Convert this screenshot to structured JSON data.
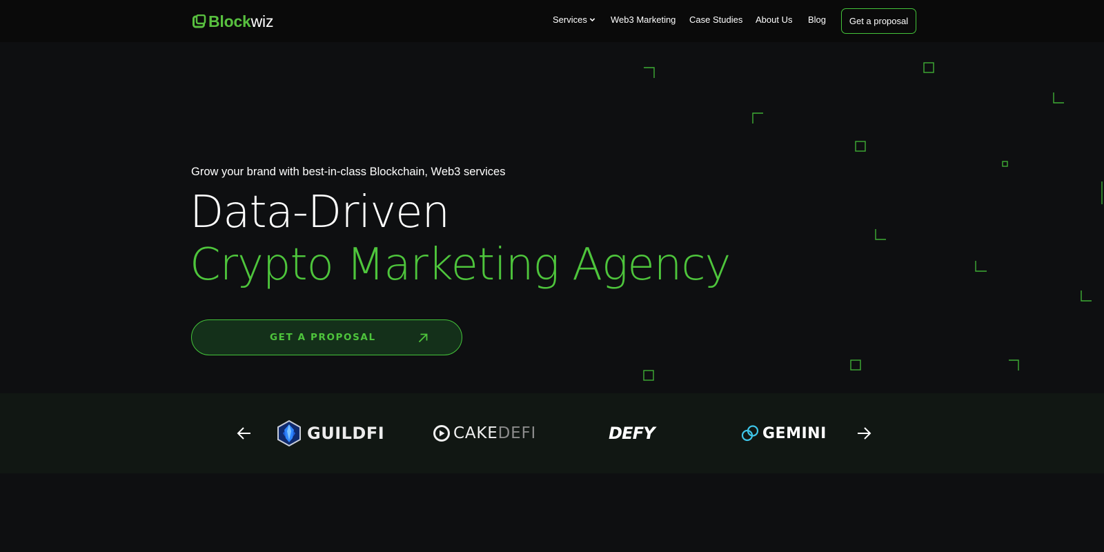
{
  "header": {
    "logo": {
      "part_a": "Block",
      "part_b": "wiz",
      "brand_color": "#58c03f"
    },
    "nav": [
      {
        "label": "Services",
        "has_dropdown": true
      },
      {
        "label": "Web3 Marketing"
      },
      {
        "label": "Case Studies"
      },
      {
        "label": "About Us"
      },
      {
        "label": "Blog"
      }
    ],
    "cta": "Get a proposal"
  },
  "hero": {
    "tagline": "Grow your brand with best-in-class Blockchain, Web3 services",
    "title_line1": "Data-Driven",
    "title_line2": "Crypto Marketing Agency",
    "cta": "GET A PROPOSAL",
    "accent_color": "#4ec53c"
  },
  "partners": {
    "prev_icon": "arrow-left-icon",
    "next_icon": "arrow-right-icon",
    "items": [
      {
        "name_a": "GUILDFI",
        "icon": "guildfi-crystal-icon"
      },
      {
        "name_a": "CAKE",
        "name_b": "DEFI",
        "icon": "cake-defi-icon"
      },
      {
        "name_a": "DEFY"
      },
      {
        "name_a": "GEMINI",
        "icon": "gemini-icon"
      }
    ]
  }
}
